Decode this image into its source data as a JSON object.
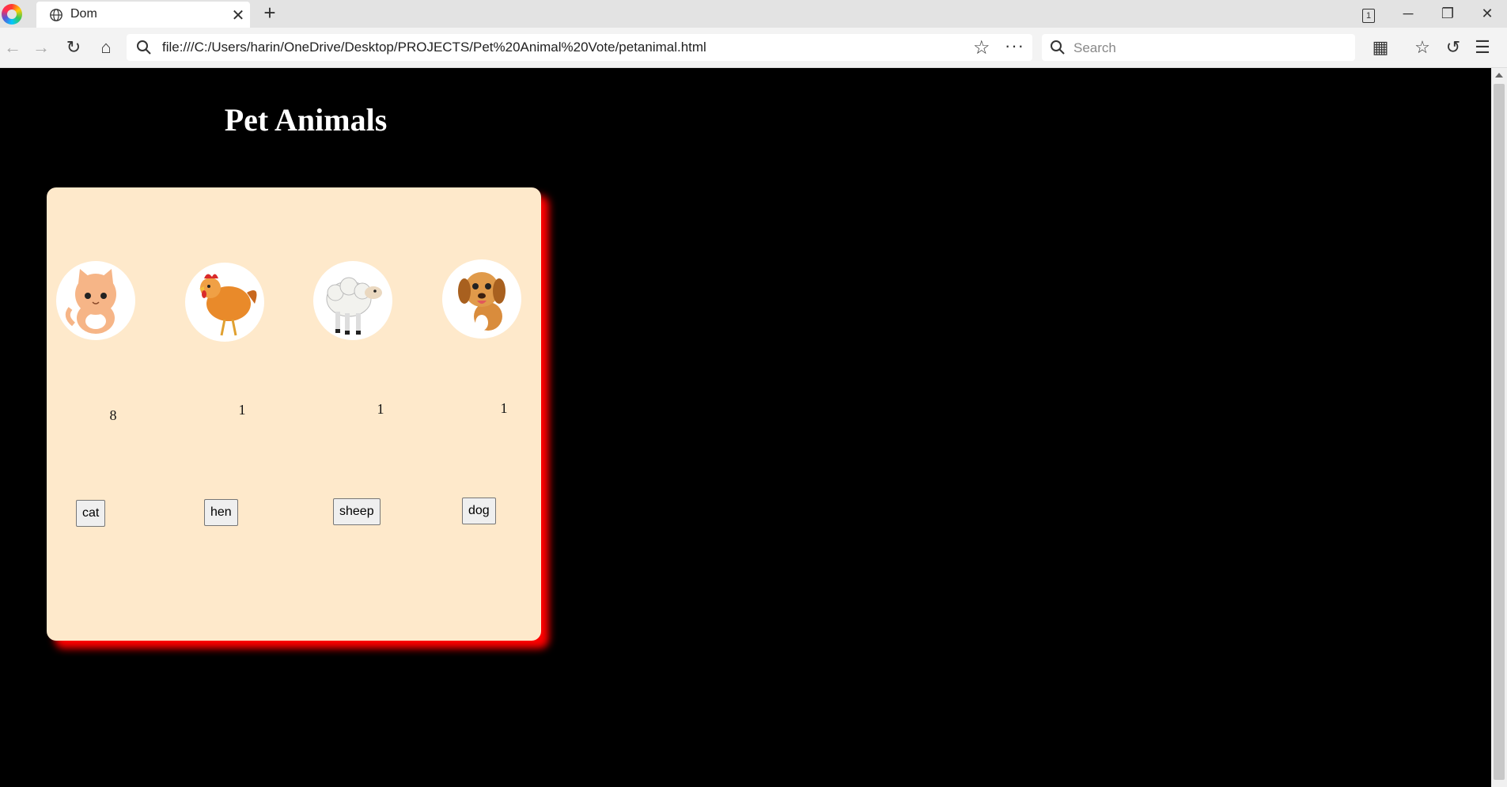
{
  "browser": {
    "tab_title": "Dom",
    "url": "file:///C:/Users/harin/OneDrive/Desktop/PROJECTS/Pet%20Animal%20Vote/petanimal.html",
    "search_placeholder": "Search",
    "tab_count": "1"
  },
  "page": {
    "heading": "Pet Animals",
    "animals": [
      {
        "name": "cat",
        "votes": "8",
        "button_label": "cat"
      },
      {
        "name": "hen",
        "votes": "1",
        "button_label": "hen"
      },
      {
        "name": "sheep",
        "votes": "1",
        "button_label": "sheep"
      },
      {
        "name": "dog",
        "votes": "1",
        "button_label": "dog"
      }
    ]
  },
  "colors": {
    "page_bg": "#000000",
    "card_bg": "#fee9cb",
    "card_shadow": "#ff0000",
    "heading": "#ffffff"
  }
}
